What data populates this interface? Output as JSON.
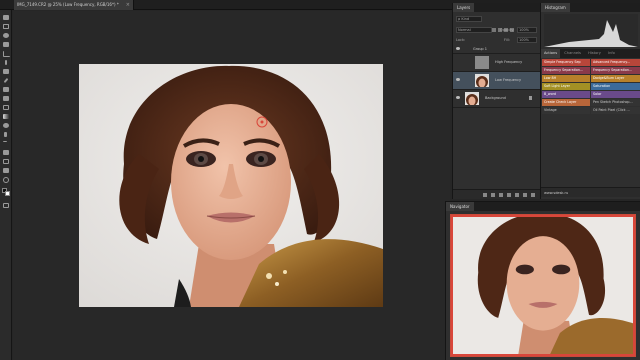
{
  "document": {
    "tab_label": "IMG_7149.CR2 @ 25% (Low Frequency, RGB/16*) *",
    "close_symbol": "×"
  },
  "layers_panel": {
    "tab_label": "Layers",
    "kind_label": "ρ Kind",
    "blend_mode": "Normal",
    "opacity_label": "Opacity:",
    "opacity_value": "100%",
    "lock_label": "Lock:",
    "fill_label": "Fill:",
    "fill_value": "100%",
    "layers": [
      {
        "name": "Group 1"
      },
      {
        "name": "High Frequency"
      },
      {
        "name": "Low Frequency"
      },
      {
        "name": "Background"
      }
    ]
  },
  "histogram_panel": {
    "tab_label": "Histogram"
  },
  "actions_panel": {
    "tabs": [
      "Actions",
      "Channels",
      "History",
      "Info"
    ],
    "actions": [
      {
        "label": "Simple Frequency Sep",
        "color": "#b8463a"
      },
      {
        "label": "Advanced Frequency...",
        "color": "#b8463a"
      },
      {
        "label": "Frequency Separation...",
        "color": "#8a3a4a"
      },
      {
        "label": "Frequency Separation...",
        "color": "#8a3a4a"
      },
      {
        "label": "Low 8H",
        "color": "#b8802a"
      },
      {
        "label": "Dodge&Burn Layer",
        "color": "#b8802a"
      },
      {
        "label": "Soft Light Layer",
        "color": "#a39024"
      },
      {
        "label": "Saturation",
        "color": "#3c6a9a"
      },
      {
        "label": "B_word",
        "color": "#6a4a8a"
      },
      {
        "label": "Solar",
        "color": "#6a4a8a"
      },
      {
        "label": "Create Check Layer",
        "color": "#b8663a"
      },
      {
        "label": "Pen Sketch Photoshop...",
        "color": "#333333"
      },
      {
        "label": "Vintage",
        "color": "#333333"
      },
      {
        "label": "Oil Paint Pixel (Click ...",
        "color": "#333333"
      }
    ],
    "footer": "www.sdesk.ru"
  },
  "navigator_panel": {
    "tab_label": "Navigator"
  },
  "colors": {
    "bg": "#262626",
    "panel": "#2f2f2f",
    "accent_red": "#d9463a",
    "selected_layer": "#44505c"
  }
}
